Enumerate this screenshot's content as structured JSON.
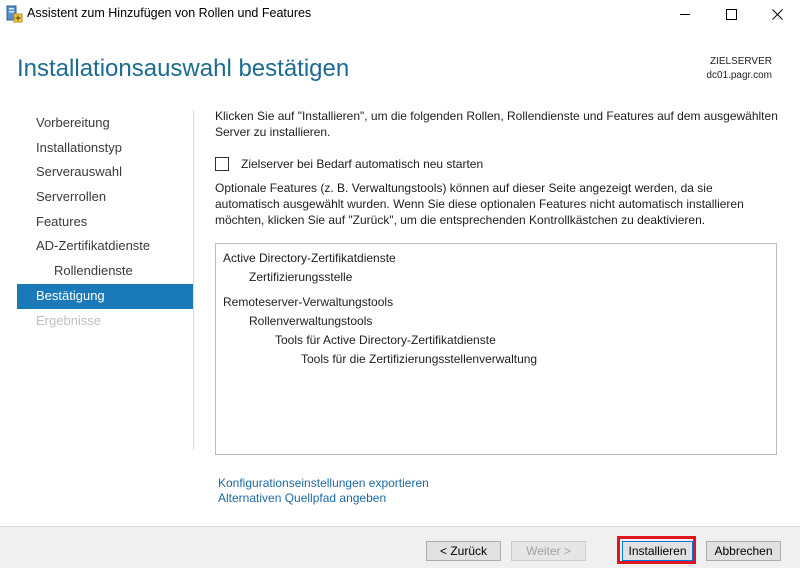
{
  "window": {
    "title": "Assistent zum Hinzufügen von Rollen und Features",
    "icon": "server-manager-icon"
  },
  "header": {
    "title": "Installationsauswahl bestätigen",
    "server_label": "ZIELSERVER",
    "server_name": "dc01.pagr.com"
  },
  "nav": {
    "items": [
      {
        "label": "Vorbereitung"
      },
      {
        "label": "Installationstyp"
      },
      {
        "label": "Serverauswahl"
      },
      {
        "label": "Serverrollen"
      },
      {
        "label": "Features"
      },
      {
        "label": "AD-Zertifikatdienste"
      },
      {
        "label": "Rollendienste"
      },
      {
        "label": "Bestätigung"
      },
      {
        "label": "Ergebnisse"
      }
    ]
  },
  "main": {
    "intro": "Klicken Sie auf \"Installieren\", um die folgenden Rollen, Rollendienste und Features auf dem ausgewählten Server zu installieren.",
    "restart_checkbox_label": "Zielserver bei Bedarf automatisch neu starten",
    "restart_checked": false,
    "optional_text": "Optionale Features (z. B. Verwaltungstools) können auf dieser Seite angezeigt werden, da sie automatisch ausgewählt wurden. Wenn Sie diese optionalen Features nicht automatisch installieren möchten, klicken Sie auf \"Zurück\", um die entsprechenden Kontrollkästchen zu deaktivieren.",
    "selection": [
      {
        "label": "Active Directory-Zertifikatdienste"
      },
      {
        "label": "Zertifizierungsstelle"
      },
      {
        "label": "Remoteserver-Verwaltungstools"
      },
      {
        "label": "Rollenverwaltungstools"
      },
      {
        "label": "Tools für Active Directory-Zertifikatdienste"
      },
      {
        "label": "Tools für die Zertifizierungsstellenverwaltung"
      }
    ],
    "export_link": "Konfigurationseinstellungen exportieren",
    "source_link": "Alternativen Quellpfad angeben"
  },
  "footer": {
    "back_label": "< Zurück",
    "next_label": "Weiter >",
    "install_label": "Installieren",
    "cancel_label": "Abbrechen"
  },
  "colors": {
    "title_accent": "#1c6b93",
    "nav_active": "#1a79b9",
    "highlight": "#e0161e",
    "link": "#1a6aa2"
  }
}
